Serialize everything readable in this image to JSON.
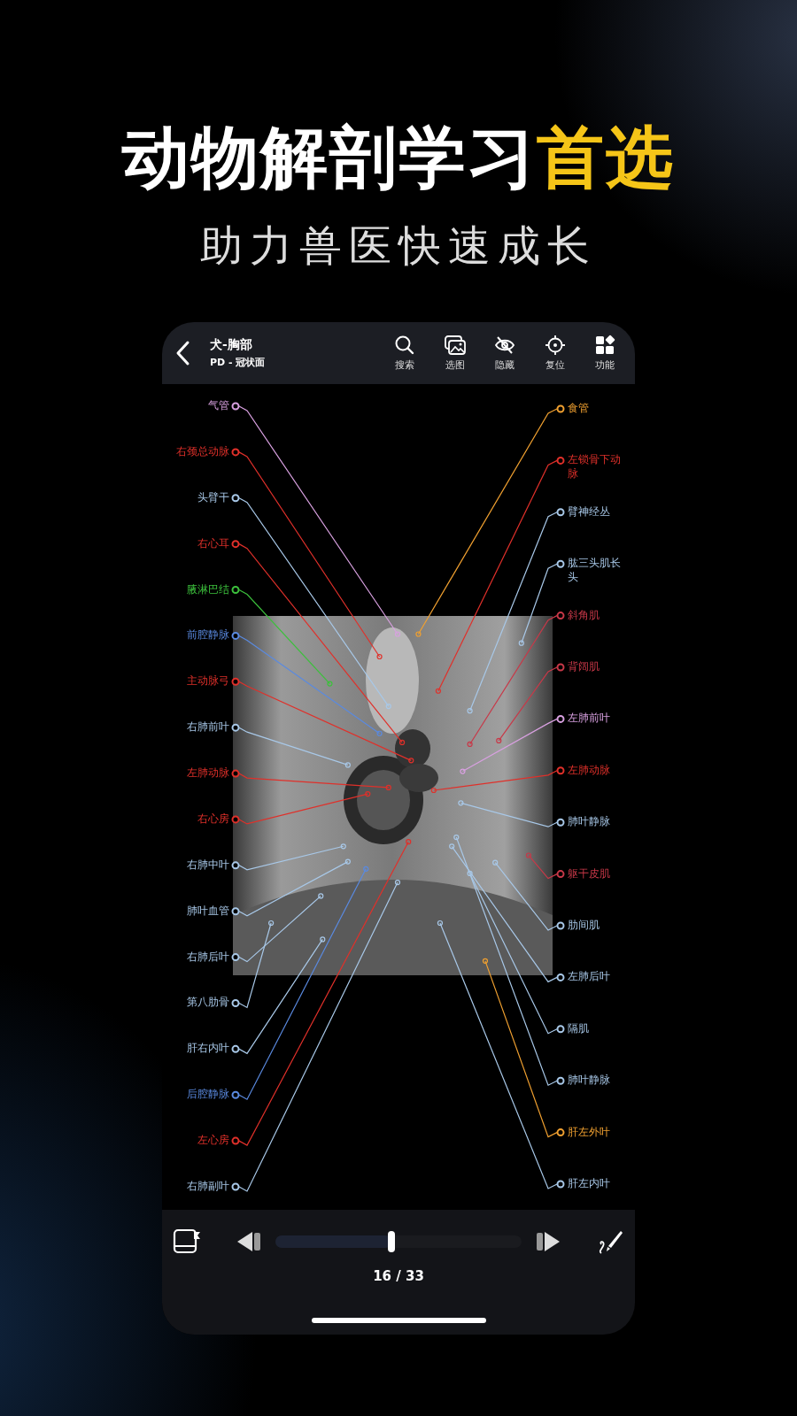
{
  "headline": {
    "main": "动物解剖学习",
    "highlight": "首选"
  },
  "subtitle": "助力兽医快速成长",
  "app": {
    "header": {
      "title": "犬-胸部",
      "subtitle": "PD - 冠状面",
      "tools": [
        {
          "kind": "search",
          "label": "搜索"
        },
        {
          "kind": "images",
          "label": "选图"
        },
        {
          "kind": "hide",
          "label": "隐藏"
        },
        {
          "kind": "reset",
          "label": "复位"
        },
        {
          "kind": "functions",
          "label": "功能"
        }
      ]
    },
    "labels_left": [
      {
        "text": "气管",
        "color": "#d8a0e0"
      },
      {
        "text": "右颈总动脉",
        "color": "#e0302a"
      },
      {
        "text": "头臂干",
        "color": "#a8c8e8"
      },
      {
        "text": "右心耳",
        "color": "#e0302a"
      },
      {
        "text": "腋淋巴结",
        "color": "#3cc03c"
      },
      {
        "text": "前腔静脉",
        "color": "#5a8ae0"
      },
      {
        "text": "主动脉弓",
        "color": "#e0302a"
      },
      {
        "text": "右肺前叶",
        "color": "#a8c8e8"
      },
      {
        "text": "左肺动脉",
        "color": "#e0302a"
      },
      {
        "text": "右心房",
        "color": "#e0302a"
      },
      {
        "text": "右肺中叶",
        "color": "#a8c8e8"
      },
      {
        "text": "肺叶血管",
        "color": "#a8c8e8"
      },
      {
        "text": "右肺后叶",
        "color": "#a8c8e8"
      },
      {
        "text": "第八肋骨",
        "color": "#a8c8e8"
      },
      {
        "text": "肝右内叶",
        "color": "#a8c8e8"
      },
      {
        "text": "后腔静脉",
        "color": "#5a8ae0"
      },
      {
        "text": "左心房",
        "color": "#e0302a"
      },
      {
        "text": "右肺副叶",
        "color": "#a8c8e8"
      }
    ],
    "labels_right": [
      {
        "text": "食管",
        "color": "#f0a030"
      },
      {
        "text": "左锁骨下动脉",
        "color": "#e0302a"
      },
      {
        "text": "臂神经丛",
        "color": "#a8c8e8"
      },
      {
        "text": "肱三头肌长头",
        "color": "#a8c8e8"
      },
      {
        "text": "斜角肌",
        "color": "#c83848"
      },
      {
        "text": "背阔肌",
        "color": "#c83848"
      },
      {
        "text": "左肺前叶",
        "color": "#d8a0e0"
      },
      {
        "text": "左肺动脉",
        "color": "#e0302a"
      },
      {
        "text": "肺叶静脉",
        "color": "#a8c8e8"
      },
      {
        "text": "躯干皮肌",
        "color": "#c83848"
      },
      {
        "text": "肋间肌",
        "color": "#a8c8e8"
      },
      {
        "text": "左肺后叶",
        "color": "#a8c8e8"
      },
      {
        "text": "隔肌",
        "color": "#a8c8e8"
      },
      {
        "text": "肺叶静脉",
        "color": "#a8c8e8"
      },
      {
        "text": "肝左外叶",
        "color": "#f0a030"
      },
      {
        "text": "肝左内叶",
        "color": "#a8c8e8"
      }
    ],
    "player": {
      "level": 0.47,
      "counter": "16 / 33"
    }
  }
}
